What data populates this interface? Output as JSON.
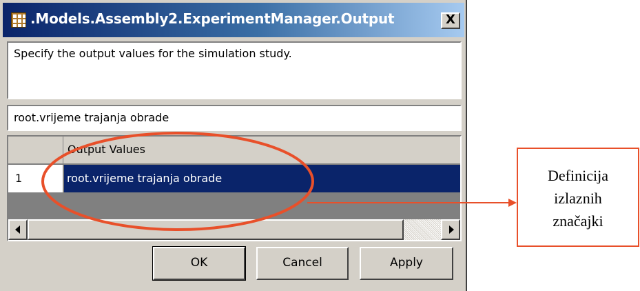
{
  "window": {
    "title": ".Models.Assembly2.ExperimentManager.Output",
    "icon": "table-icon",
    "close_label": "X"
  },
  "description": "Specify the output values for the simulation study.",
  "selected_value": "root.vrijeme trajanja obrade",
  "grid": {
    "column_header": "Output Values",
    "rows": [
      {
        "index": "1",
        "value": "root.vrijeme trajanja obrade"
      }
    ]
  },
  "buttons": {
    "ok": "OK",
    "cancel": "Cancel",
    "apply": "Apply"
  },
  "annotation": {
    "lines": [
      "Definicija",
      "izlaznih",
      "značajki"
    ],
    "color": "#e8502a"
  },
  "colors": {
    "titlebar_start": "#0a246a",
    "titlebar_end": "#a6caf0",
    "selection": "#0a246a",
    "dialog_face": "#d4d0c8"
  }
}
